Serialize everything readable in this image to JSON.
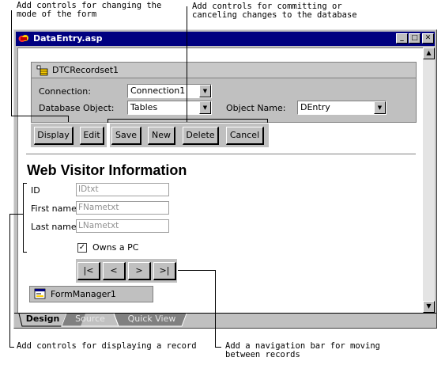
{
  "callouts": {
    "top_left": "Add controls for changing the\nmode of the form",
    "top_right": "Add controls for committing or\ncanceling changes to the database",
    "bottom_left": "Add controls for displaying a record",
    "bottom_right": "Add a navigation bar for moving\nbetween records"
  },
  "window": {
    "title": "DataEntry.asp",
    "minimize_glyph": "_",
    "maximize_glyph": "□",
    "close_glyph": "✕",
    "scroll_up_glyph": "▲",
    "scroll_down_glyph": "▼"
  },
  "recordset": {
    "name": "DTCRecordset1",
    "connection_label": "Connection:",
    "connection_value": "Connection1",
    "db_object_label": "Database Object:",
    "db_object_value": "Tables",
    "object_name_label": "Object Name:",
    "object_name_value": "DEntry",
    "dropdown_glyph": "▼"
  },
  "mode_buttons": [
    "Display",
    "Edit"
  ],
  "commit_buttons": [
    "Save",
    "New",
    "Delete",
    "Cancel"
  ],
  "form": {
    "heading": "Web Visitor Information",
    "fields": [
      {
        "label": "ID",
        "placeholder": "IDtxt"
      },
      {
        "label": "First name",
        "placeholder": "FNametxt"
      },
      {
        "label": "Last name",
        "placeholder": "LNametxt"
      }
    ],
    "checkbox_label": "Owns a PC",
    "checkbox_checked": true,
    "checkbox_glyph": "✓"
  },
  "nav_buttons": [
    "|<",
    "<",
    ">",
    ">|"
  ],
  "form_manager": "FormManager1",
  "tabs": [
    "Design",
    "Source",
    "Quick View"
  ]
}
